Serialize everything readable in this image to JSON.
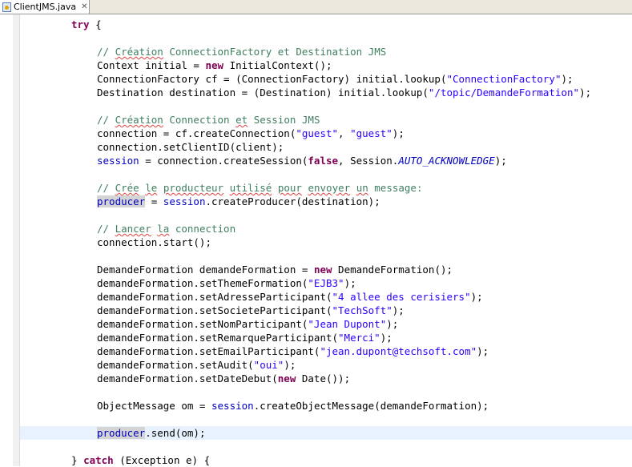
{
  "tab": {
    "title": "ClientJMS.java",
    "icon": "java-file-icon",
    "close_icon": "close-icon"
  },
  "code": {
    "l1": {
      "kw_try": "try",
      "brace": " {"
    },
    "l3": {
      "comment_a": "// ",
      "w1": "Création",
      "comment_b": " ConnectionFactory et Destination JMS"
    },
    "l4": {
      "a": "Context initial = ",
      "kw_new": "new",
      "b": " InitialContext();"
    },
    "l5": {
      "a": "ConnectionFactory cf = (ConnectionFactory) initial.lookup(",
      "s": "\"ConnectionFactory\"",
      "b": ");"
    },
    "l6": {
      "a": "Destination destination = (Destination) initial.lookup(",
      "s": "\"/topic/DemandeFormation\"",
      "b": ");"
    },
    "l8": {
      "comment_a": "// ",
      "w1": "Création",
      "comment_b": " Connection ",
      "w2": "et",
      "comment_c": " Session JMS"
    },
    "l9": {
      "a": "connection = cf.createConnection(",
      "s1": "\"guest\"",
      "mid": ", ",
      "s2": "\"guest\"",
      "b": ");"
    },
    "l10": {
      "a": "connection.setClientID(client);"
    },
    "l11": {
      "f": "session",
      "a": " = connection.createSession(",
      "kw_false": "false",
      "b": ", Session.",
      "c": "AUTO_ACKNOWLEDGE",
      "d": ");"
    },
    "l13": {
      "comment_a": "// ",
      "w1": "Crée",
      "sp1": " ",
      "w2": "le",
      "sp2": " ",
      "w3": "producteur",
      "sp3": " ",
      "w4": "utilisé",
      "sp4": " ",
      "w5": "pour",
      "sp5": " ",
      "w6": "envoyer",
      "sp6": " ",
      "w7": "un",
      "sp7": " message:"
    },
    "l14": {
      "f1": "producer",
      "a": " = ",
      "f2": "session",
      "b": ".createProducer(destination);"
    },
    "l16": {
      "comment_a": "// ",
      "w1": "Lancer",
      "sp1": " ",
      "w2": "la",
      "comment_b": " connection"
    },
    "l17": {
      "a": "connection.start();"
    },
    "l19": {
      "a": "DemandeFormation demandeFormation = ",
      "kw_new": "new",
      "b": " DemandeFormation();"
    },
    "l20": {
      "a": "demandeFormation.setThemeFormation(",
      "s": "\"EJB3\"",
      "b": ");"
    },
    "l21": {
      "a": "demandeFormation.setAdresseParticipant(",
      "s": "\"4 allee des cerisiers\"",
      "b": ");"
    },
    "l22": {
      "a": "demandeFormation.setSocieteParticipant(",
      "s": "\"TechSoft\"",
      "b": ");"
    },
    "l23": {
      "a": "demandeFormation.setNomParticipant(",
      "s": "\"Jean Dupont\"",
      "b": ");"
    },
    "l24": {
      "a": "demandeFormation.setRemarqueParticipant(",
      "s": "\"Merci\"",
      "b": ");"
    },
    "l25": {
      "a": "demandeFormation.setEmailParticipant(",
      "s": "\"jean.dupont@techsoft.com\"",
      "b": ");"
    },
    "l26": {
      "a": "demandeFormation.setAudit(",
      "s": "\"oui\"",
      "b": ");"
    },
    "l27": {
      "a": "demandeFormation.setDateDebut(",
      "kw_new": "new",
      "b": " Date());"
    },
    "l29": {
      "a": "ObjectMessage om = ",
      "f": "session",
      "b": ".createObjectMessage(demandeFormation);"
    },
    "l31": {
      "f": "producer",
      "a": ".send(om);"
    },
    "l33": {
      "a": "} ",
      "kw_catch": "catch",
      "b": " (Exception e) {"
    }
  },
  "colors": {
    "keyword": "#7f0055",
    "string": "#2a00ff",
    "comment": "#3f7f5f",
    "field": "#0000c0",
    "current_line": "#e8f2fe"
  }
}
